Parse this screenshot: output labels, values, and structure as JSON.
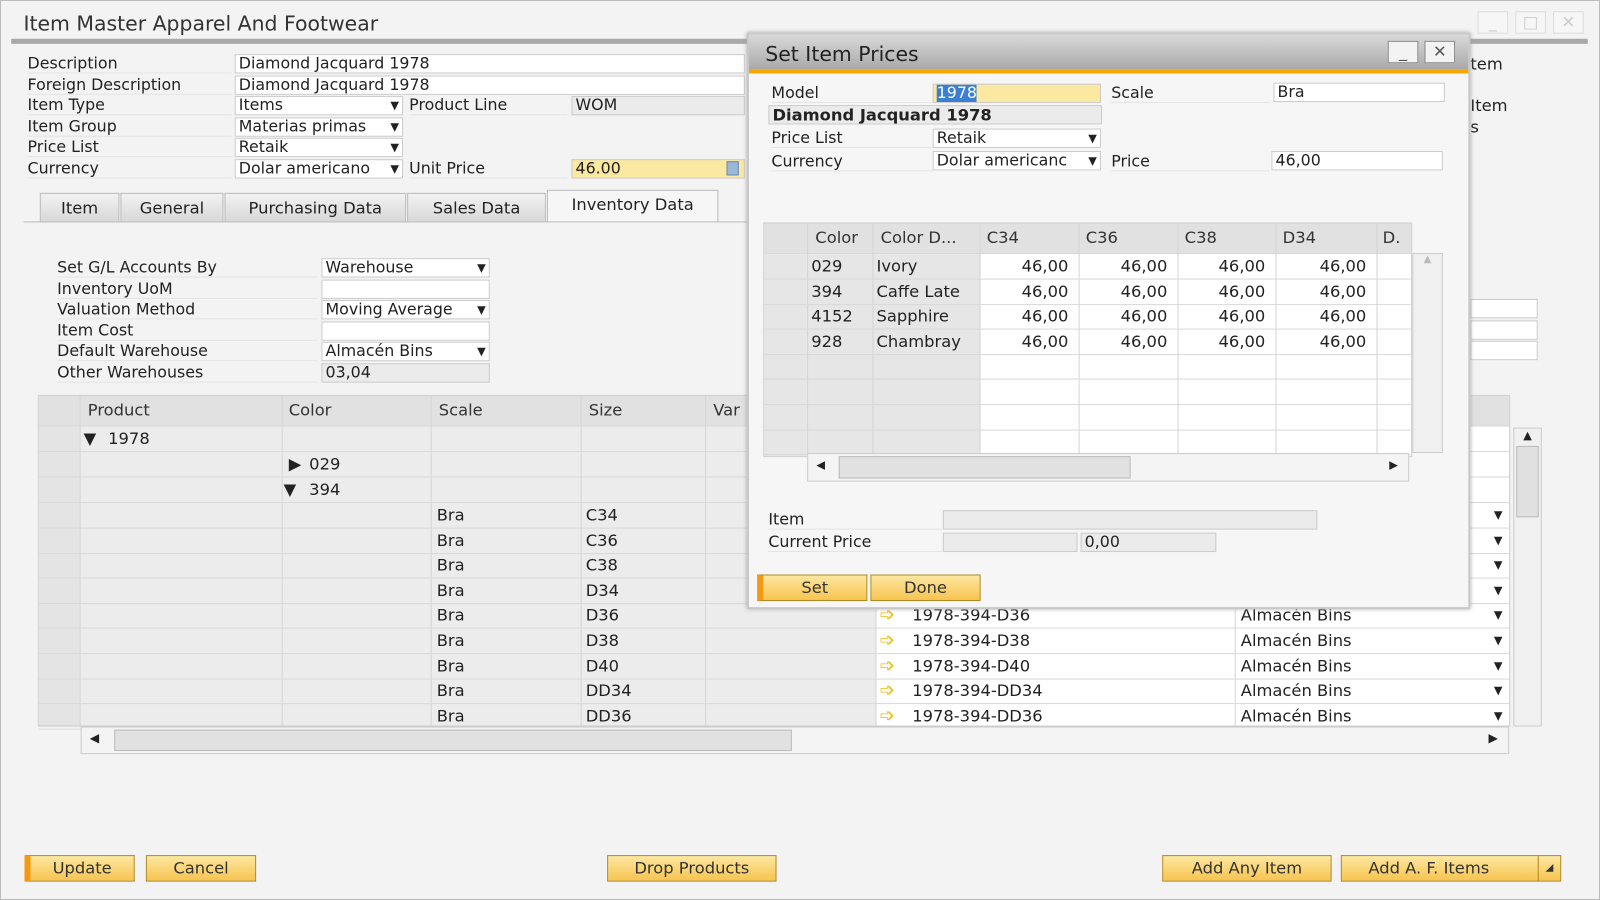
{
  "window": {
    "title": "Item Master Apparel And Footwear",
    "minimize": "_",
    "maximize": "□",
    "close": "✕"
  },
  "header": {
    "description_label": "Description",
    "description": "Diamond Jacquard 1978",
    "foreign_label": "Foreign Description",
    "foreign": "Diamond Jacquard 1978",
    "item_type_label": "Item Type",
    "item_type": "Items",
    "product_line_label": "Product Line",
    "product_line": "WOM",
    "item_group_label": "Item Group",
    "item_group": "Materias primas",
    "price_list_label": "Price List",
    "price_list": "Retaik",
    "currency_label": "Currency",
    "currency": "Dolar americano",
    "unit_price_label": "Unit Price",
    "unit_price": "46.00"
  },
  "tabs": [
    "Item",
    "General",
    "Purchasing Data",
    "Sales Data",
    "Inventory Data"
  ],
  "inventory": {
    "gl_label": "Set G/L Accounts By",
    "gl": "Warehouse",
    "uom_label": "Inventory UoM",
    "uom": "",
    "valuation_label": "Valuation Method",
    "valuation": "Moving Average",
    "cost_label": "Item Cost",
    "cost": "",
    "default_wh_label": "Default Warehouse",
    "default_wh": "Almacén Bins",
    "other_wh_label": "Other Warehouses",
    "other_wh": "03,04"
  },
  "right_partial": {
    "a": "tem",
    "b": "Item",
    "c": "s"
  },
  "products_table": {
    "columns": [
      "Product",
      "Color",
      "Scale",
      "Size",
      "Var"
    ],
    "tree": [
      {
        "level": 0,
        "label": "1978",
        "expanded": true
      },
      {
        "level": 1,
        "label": "029",
        "expanded": false
      },
      {
        "level": 1,
        "label": "394",
        "expanded": true
      }
    ],
    "rows": [
      {
        "scale": "Bra",
        "size": "C34",
        "code": "",
        "wh": ""
      },
      {
        "scale": "Bra",
        "size": "C36",
        "code": "",
        "wh": ""
      },
      {
        "scale": "Bra",
        "size": "C38",
        "code": "",
        "wh": ""
      },
      {
        "scale": "Bra",
        "size": "D34",
        "code": "",
        "wh": ""
      },
      {
        "scale": "Bra",
        "size": "D36",
        "code": "1978-394-D36",
        "wh": "Almacén Bins"
      },
      {
        "scale": "Bra",
        "size": "D38",
        "code": "1978-394-D38",
        "wh": "Almacén Bins"
      },
      {
        "scale": "Bra",
        "size": "D40",
        "code": "1978-394-D40",
        "wh": "Almacén Bins"
      },
      {
        "scale": "Bra",
        "size": "DD34",
        "code": "1978-394-DD34",
        "wh": "Almacén Bins"
      },
      {
        "scale": "Bra",
        "size": "DD36",
        "code": "1978-394-DD36",
        "wh": "Almacén Bins"
      }
    ]
  },
  "footer": {
    "update": "Update",
    "cancel": "Cancel",
    "drop": "Drop Products",
    "add_any": "Add Any Item",
    "add_af": "Add A. F. Items"
  },
  "dialog": {
    "title": "Set Item Prices",
    "model_label": "Model",
    "model": "1978",
    "scale_label": "Scale",
    "scale": "Bra",
    "description": "Diamond Jacquard 1978",
    "price_list_label": "Price List",
    "price_list": "Retaik",
    "currency_label": "Currency",
    "currency": "Dolar americanc",
    "price_label": "Price",
    "price": "46,00",
    "columns": [
      "Color",
      "Color D...",
      "C34",
      "C36",
      "C38",
      "D34",
      "D."
    ],
    "rows": [
      {
        "color": "029",
        "desc": "Ivory",
        "v": [
          "46,00",
          "46,00",
          "46,00",
          "46,00"
        ]
      },
      {
        "color": "394",
        "desc": "Caffe Late",
        "v": [
          "46,00",
          "46,00",
          "46,00",
          "46,00"
        ]
      },
      {
        "color": "4152",
        "desc": "Sapphire",
        "v": [
          "46,00",
          "46,00",
          "46,00",
          "46,00"
        ]
      },
      {
        "color": "928",
        "desc": "Chambray",
        "v": [
          "46,00",
          "46,00",
          "46,00",
          "46,00"
        ]
      }
    ],
    "item_label": "Item",
    "item": "",
    "current_price_label": "Current Price",
    "current_price": "0,00",
    "set": "Set",
    "done": "Done"
  }
}
